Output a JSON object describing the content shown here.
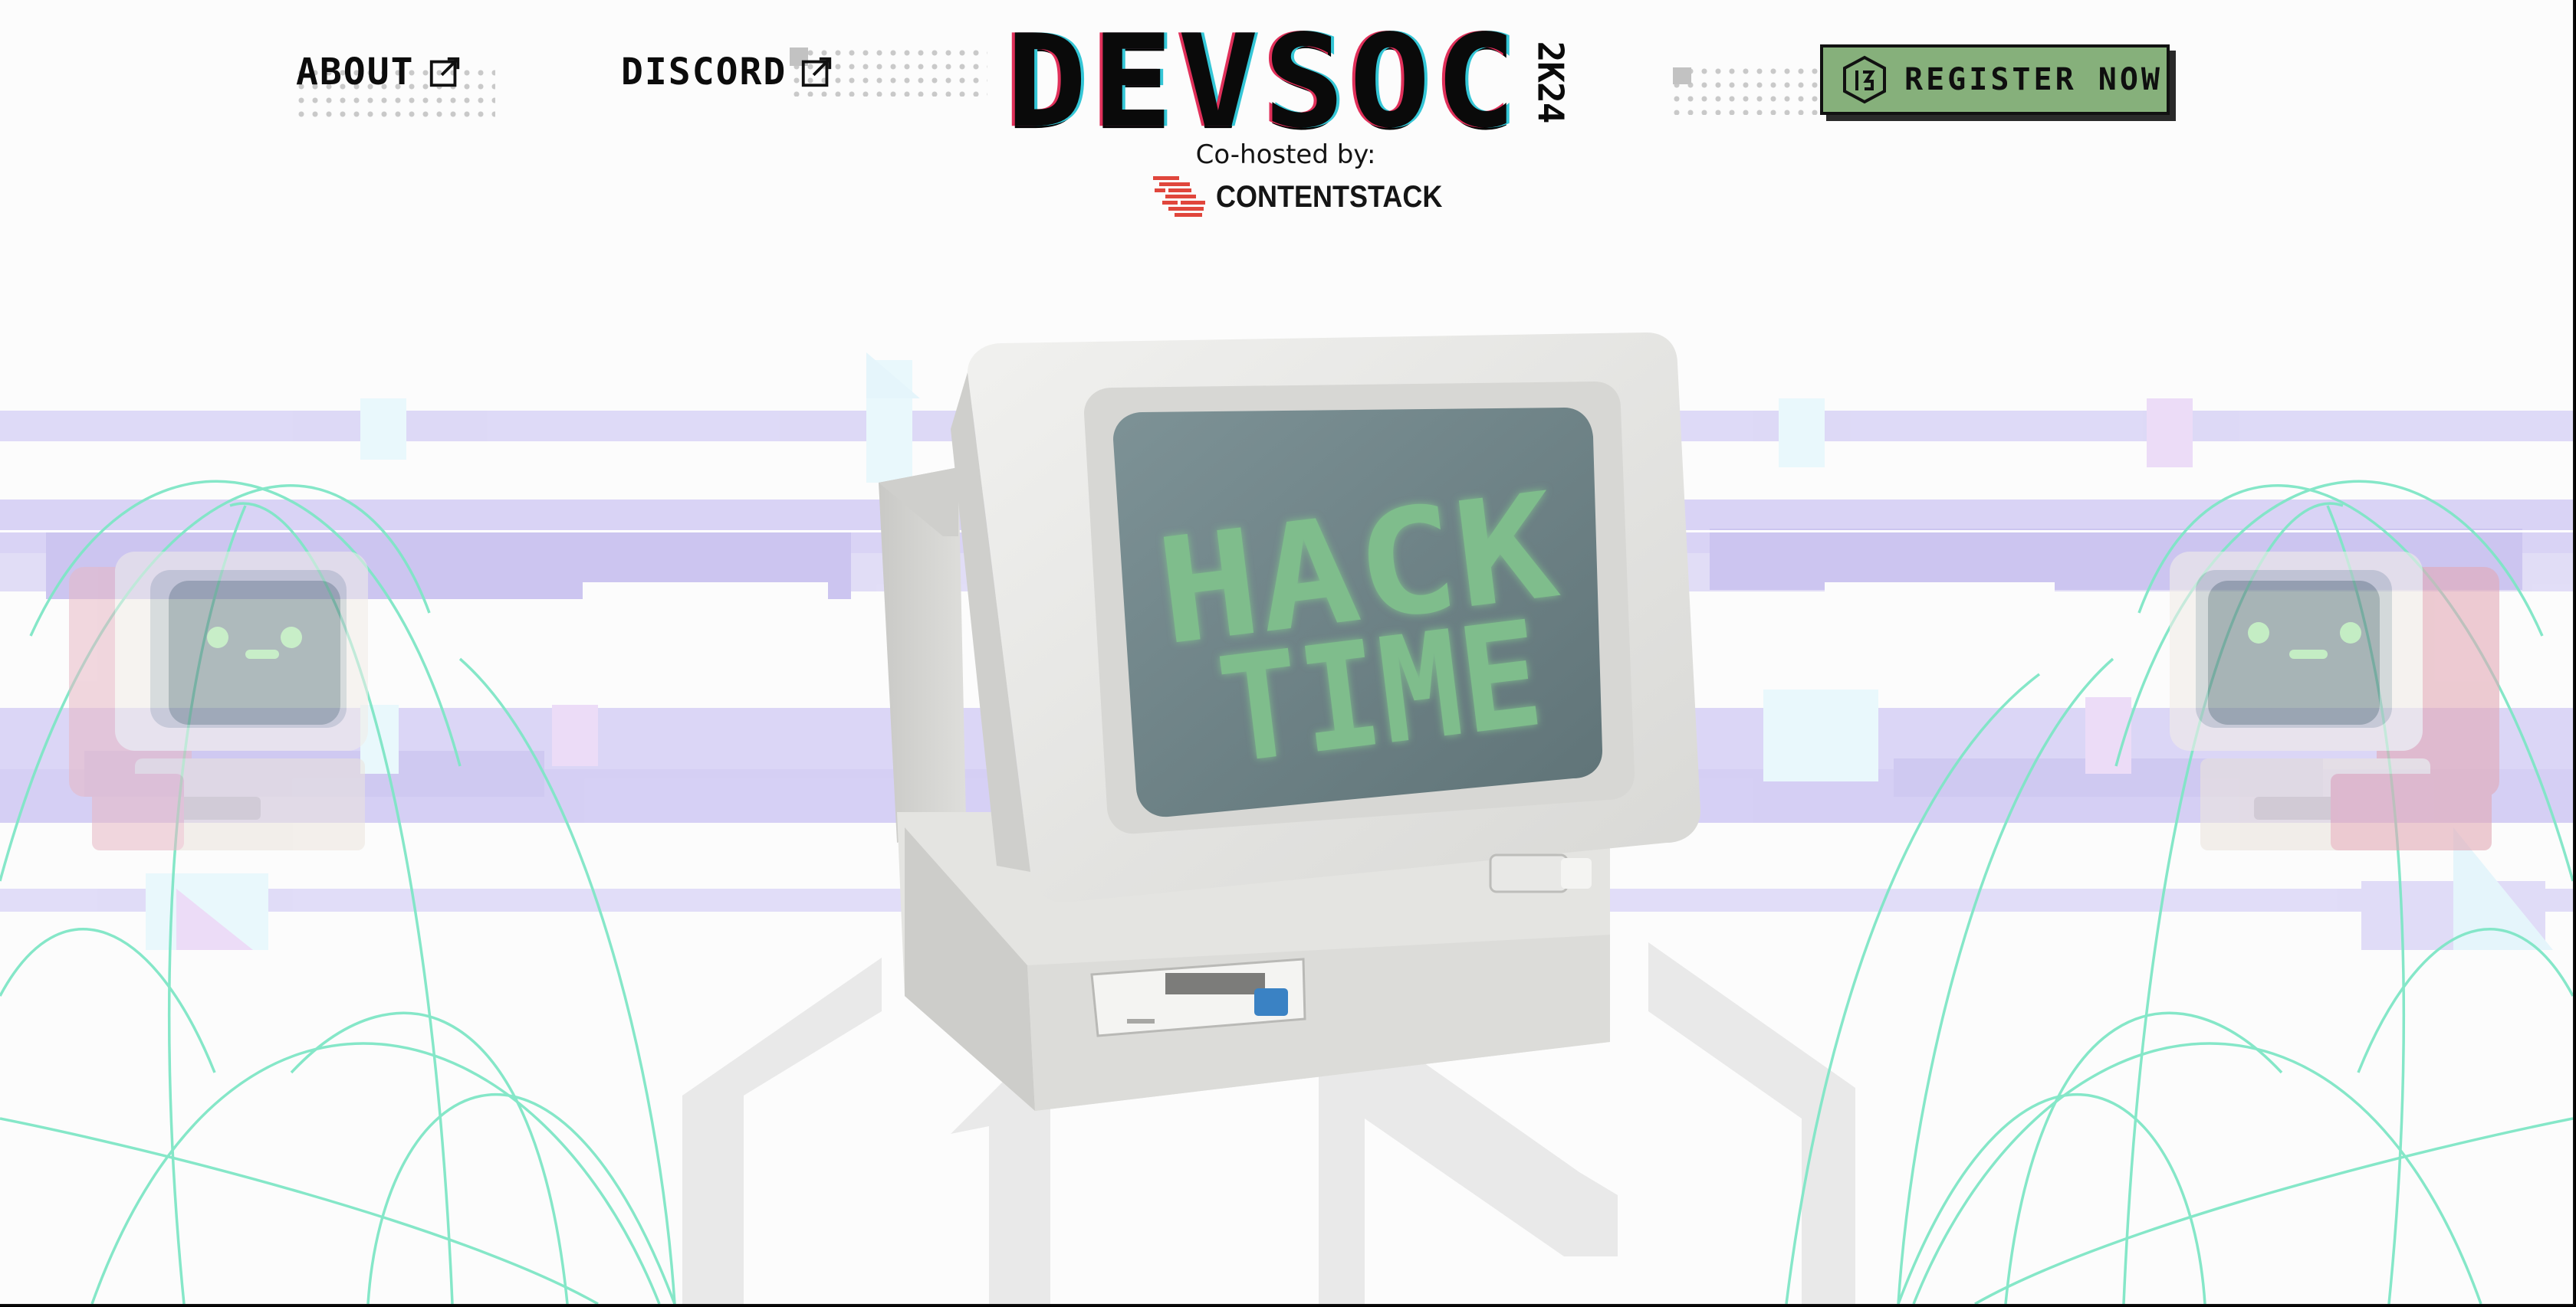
{
  "nav": {
    "about_label": "ABOUT",
    "discord_label": "DISCORD"
  },
  "brand": {
    "title": "DEVSOC",
    "year": "2K24",
    "cohost_text": "Co-hosted by:",
    "sponsor_name": "CONTENTSTACK"
  },
  "cta": {
    "register_label": "REGISTER NOW"
  },
  "hero": {
    "screen_text_line1": "HACK",
    "screen_text_line2": "TIME"
  },
  "icons": {
    "about": "external-link-icon",
    "discord": "external-link-icon",
    "register": "devsoc-hex-logo-icon",
    "sponsor": "contentstack-logo-icon"
  },
  "colors": {
    "background": "#fcfcfc",
    "register_button": "#86b07b",
    "screen_text": "#7fbd8c",
    "glitch_purple": "#d3cdf4",
    "wave_lines": "#7fe6c6",
    "sponsor_red": "#e0463c"
  }
}
